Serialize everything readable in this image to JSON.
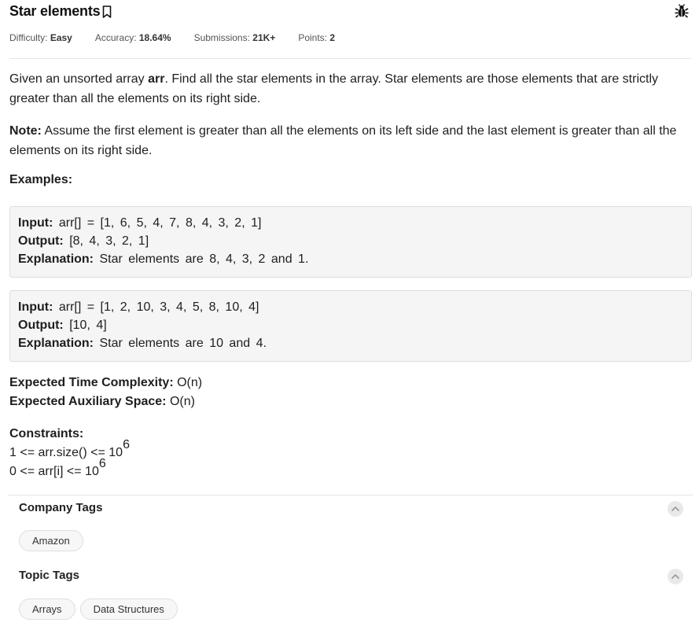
{
  "header": {
    "title": "Star elements"
  },
  "meta": {
    "difficulty_label": "Difficulty:",
    "difficulty_value": "Easy",
    "accuracy_label": "Accuracy:",
    "accuracy_value": "18.64%",
    "submissions_label": "Submissions:",
    "submissions_value": "21K+",
    "points_label": "Points:",
    "points_value": "2"
  },
  "problem": {
    "p1_a": "Given an unsorted array ",
    "p1_b": "arr",
    "p1_c": ". Find all the star elements in the array. Star elements are those elements that are strictly greater than all the elements on its right side.",
    "note_label": "Note:",
    "note_text": " Assume the first element is greater than all the elements on its left side and the last element is greater than all the elements on its right side.",
    "examples_label": "Examples:"
  },
  "examples": [
    {
      "input_label": "Input:",
      "input_value": " arr[] = [1, 6, 5, 4, 7, 8, 4, 3, 2, 1]",
      "output_label": "Output:",
      "output_value": " [8, 4, 3, 2, 1]",
      "explanation_label": "Explanation:",
      "explanation_value": " Star elements are 8, 4, 3, 2 and 1."
    },
    {
      "input_label": "Input:",
      "input_value": " arr[] = [1, 2, 10, 3, 4, 5, 8, 10, 4]",
      "output_label": "Output:",
      "output_value": " [10, 4]",
      "explanation_label": "Explanation:",
      "explanation_value": " Star elements are 10 and 4."
    }
  ],
  "complexity": {
    "time_label": "Expected Time Complexity:",
    "time_value": " O(n)",
    "space_label": "Expected Auxiliary Space:",
    "space_value": " O(n)"
  },
  "constraints": {
    "label": "Constraints:",
    "c1": "1 <= arr.size() <= 10",
    "c1_exp": "6",
    "c2": "0 <= arr[i] <= 10",
    "c2_exp": "6"
  },
  "company_tags": {
    "title": "Company Tags",
    "items": [
      "Amazon"
    ]
  },
  "topic_tags": {
    "title": "Topic Tags",
    "items": [
      "Arrays",
      "Data Structures"
    ]
  },
  "icons": {
    "bookmark": "bookmark-icon",
    "bug": "bug-icon",
    "chevron": "chevron-up-icon"
  }
}
